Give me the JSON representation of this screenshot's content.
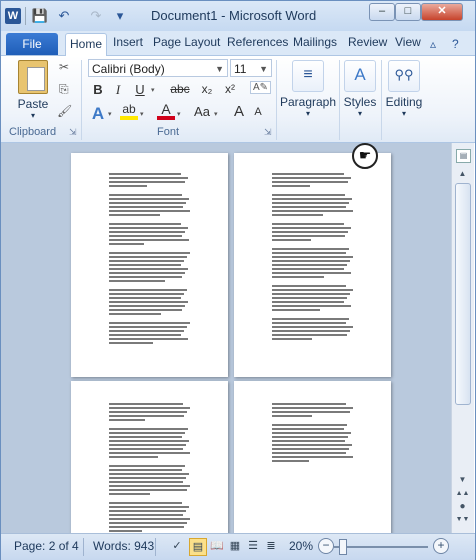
{
  "window": {
    "title": "Document1  -  Microsoft Word",
    "app_icon": "W",
    "quick_access": [
      {
        "name": "save-icon",
        "glyph": "💾"
      },
      {
        "name": "undo-icon",
        "glyph": "↶"
      },
      {
        "name": "redo-icon",
        "glyph": "↷"
      },
      {
        "name": "customize-qat-icon",
        "glyph": "▾"
      }
    ],
    "controls": {
      "minimize": "–",
      "maximize": "□",
      "close": "✕"
    }
  },
  "tabs": {
    "file": "File",
    "items": [
      "Home",
      "Insert",
      "Page Layout",
      "References",
      "Mailings",
      "Review",
      "View"
    ],
    "active": "Home"
  },
  "ribbon": {
    "clipboard": {
      "label": "Clipboard",
      "paste": "Paste",
      "cut_icon": "✂",
      "copy_icon": "⎘",
      "format_painter_icon": "🖌"
    },
    "font": {
      "label": "Font",
      "font_name": "Calibri (Body)",
      "font_size": "11",
      "grow_icon": "A▲",
      "shrink_icon": "A▼",
      "clear_icon": "A⌫",
      "bold": "B",
      "italic": "I",
      "underline": "U",
      "strikethrough": "abc",
      "subscript": "x₂",
      "superscript": "x²",
      "text_effects": "A",
      "highlight": "ab",
      "font_color": "A",
      "change_case": "Aa",
      "grow_font": "A",
      "shrink_font": "A"
    },
    "paragraph": {
      "label": "Paragraph"
    },
    "styles": {
      "label": "Styles"
    },
    "editing": {
      "label": "Editing"
    }
  },
  "status": {
    "page": "Page: 2 of 4",
    "words": "Words: 943",
    "zoom": "20%",
    "zoom_minus": "−",
    "zoom_plus": "+",
    "zoom_level": 0.2
  },
  "colors": {
    "accent": "#2b5797",
    "file_tab": "#1f5eb8",
    "highlight_yellow": "#ffe800",
    "font_red": "#d0021b"
  }
}
